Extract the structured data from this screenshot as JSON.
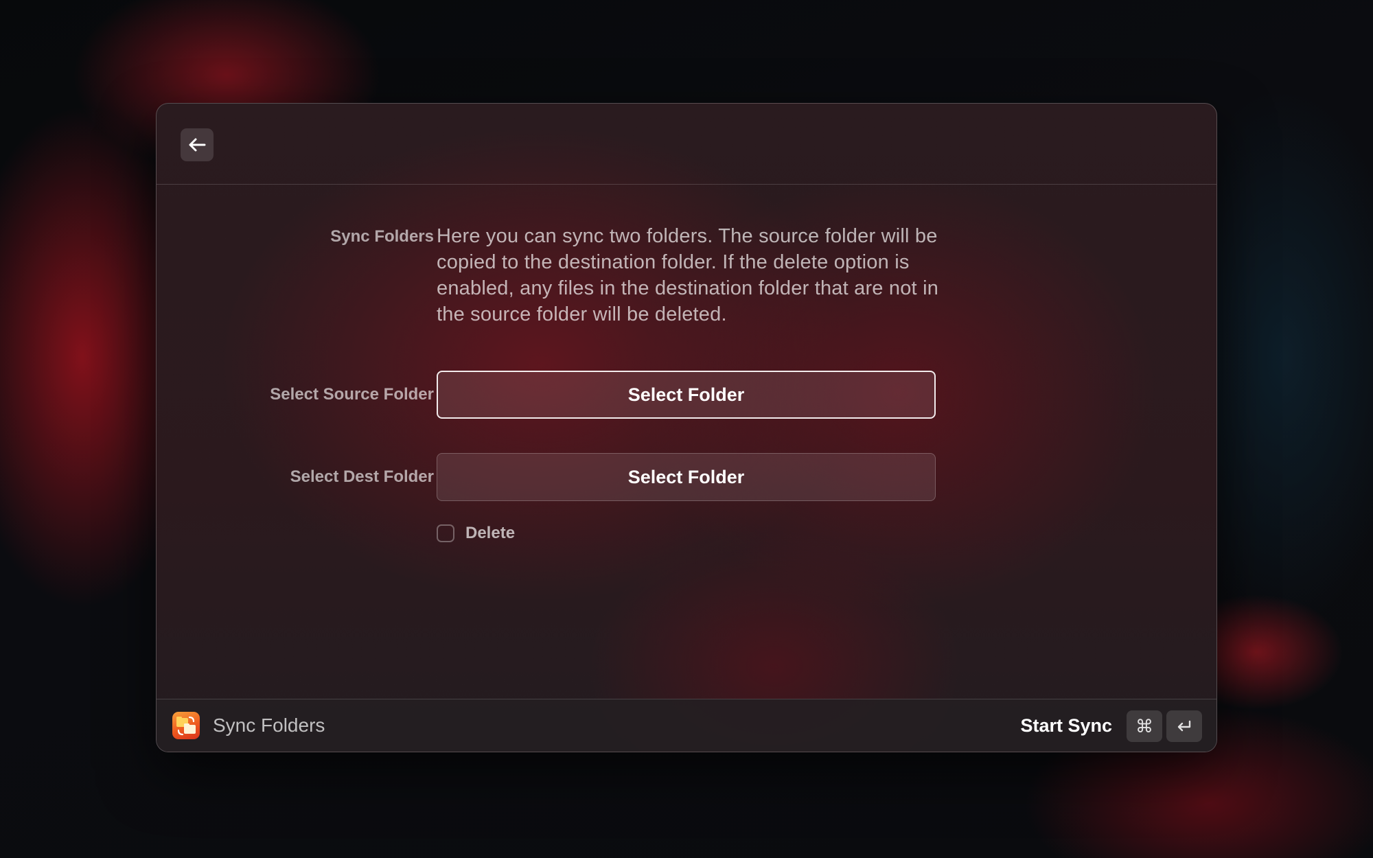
{
  "window": {
    "description_label": "Sync Folders",
    "description": "Here you can sync two folders. The source folder will be copied to the destination folder. If the delete option is enabled, any files in the destination folder that are not in the source folder will be deleted.",
    "source": {
      "label": "Select Source Folder",
      "button_label": "Select Folder"
    },
    "dest": {
      "label": "Select Dest Folder",
      "button_label": "Select Folder"
    },
    "delete_option": {
      "label": "Delete",
      "checked": false
    }
  },
  "footer": {
    "app_title": "Sync Folders",
    "primary_action": "Start Sync",
    "shortcut": [
      "⌘",
      "↵"
    ]
  },
  "icons": {
    "back": "arrow-left-icon",
    "app": "sync-folders-app-icon"
  },
  "colors": {
    "accent_border": "#f3eced",
    "app_icon_orange": "#ee5a1f"
  }
}
